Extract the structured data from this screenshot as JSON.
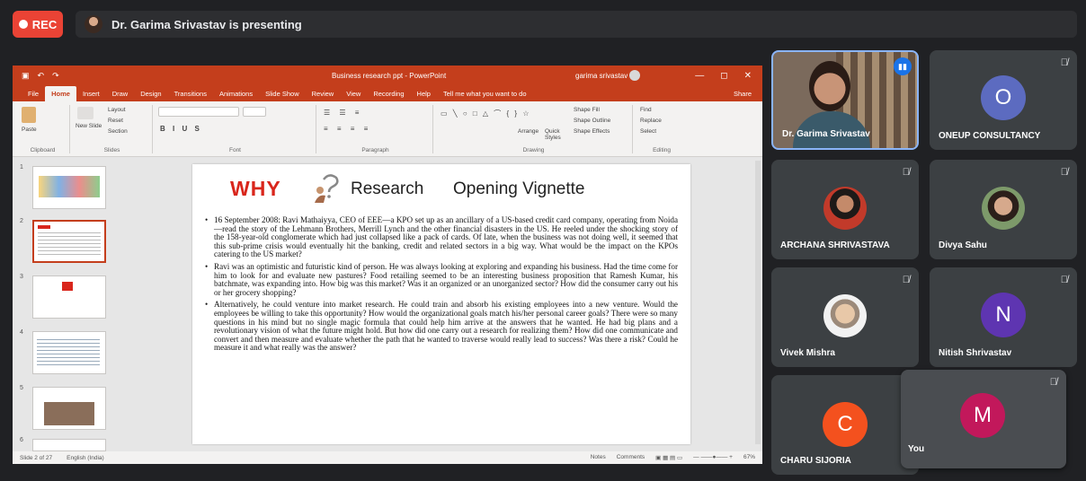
{
  "top": {
    "rec_label": "REC",
    "presenting_text": "Dr. Garima Srivastav is presenting"
  },
  "powerpoint": {
    "doc_title": "Business research ppt - PowerPoint",
    "user_name": "garima srivastav",
    "tabs": [
      "File",
      "Home",
      "Insert",
      "Draw",
      "Design",
      "Transitions",
      "Animations",
      "Slide Show",
      "Review",
      "View",
      "Recording",
      "Help",
      "Tell me what you want to do"
    ],
    "share_label": "Share",
    "ribbon": {
      "paste": "Paste",
      "new_slide": "New Slide",
      "layout": "Layout",
      "reset": "Reset",
      "section": "Section",
      "arrange": "Arrange",
      "quick_styles": "Quick Styles",
      "shape_fill": "Shape Fill",
      "shape_outline": "Shape Outline",
      "shape_effects": "Shape Effects",
      "find": "Find",
      "replace": "Replace",
      "select": "Select",
      "groups": [
        "Clipboard",
        "Slides",
        "Font",
        "Paragraph",
        "Drawing",
        "Editing"
      ]
    },
    "slide_numbers": [
      "1",
      "2",
      "3",
      "4",
      "5",
      "6"
    ],
    "slide": {
      "why": "WHY",
      "research": "Research",
      "subtitle": "Opening Vignette",
      "bullets": [
        "16 September 2008: Ravi Mathaiyya, CEO of EEE—a KPO set up as an ancillary of a US-based credit card company, operating from Noida—read the story of the Lehmann Brothers, Merrill Lynch and the other financial disasters in the US. He reeled under the shocking story of the 158-year-old conglomerate which had just collapsed like a pack of cards. Of late, when the business was not doing well, it seemed that this sub-prime crisis would eventually hit the banking, credit and related sectors in a big way. What would be the impact on the KPOs catering to the US market?",
        "Ravi was an optimistic and futuristic kind of person. He was always looking at exploring and expanding his business. Had the time come for him to look for and evaluate new pastures? Food retailing seemed to be an interesting business proposition that Ramesh Kumar, his batchmate, was expanding into. How big was this market? Was it an organized or an unorganized sector? How did the consumer carry out his or her grocery shopping?",
        "Alternatively, he could venture into market research. He could train and absorb his existing employees into a new venture. Would the employees be willing to take this opportunity? How would the organizational goals match his/her personal career goals? There were so many questions in his mind but no single magic formula that could help him arrive at the answers that he wanted. He had big plans and a revolutionary vision of what the future might hold. But how did one carry out a research for realizing them? How did one communicate and convert and then measure and evaluate whether the path that he wanted to traverse would really lead to success? Was there a risk? Could he measure it and what really was the answer?"
      ]
    },
    "status": {
      "slide_count": "Slide 2 of 27",
      "language": "English (India)",
      "notes": "Notes",
      "comments": "Comments",
      "zoom": "67%"
    }
  },
  "participants": {
    "garima": "Dr. Garima Srivastav",
    "oneup": {
      "name": "ONEUP CONSULTANCY",
      "initial": "O",
      "color": "#5c6bc0"
    },
    "archana": "ARCHANA SHRIVASTAVA",
    "divya": "Divya Sahu",
    "vivek": "Vivek Mishra",
    "nitish": {
      "name": "Nitish Shrivastav",
      "initial": "N",
      "color": "#5e35b1"
    },
    "charu": {
      "name": "CHARU SIJORIA",
      "initial": "C",
      "color": "#f4511e"
    },
    "you": {
      "name": "You",
      "initial": "M",
      "color": "#c2185b"
    }
  }
}
